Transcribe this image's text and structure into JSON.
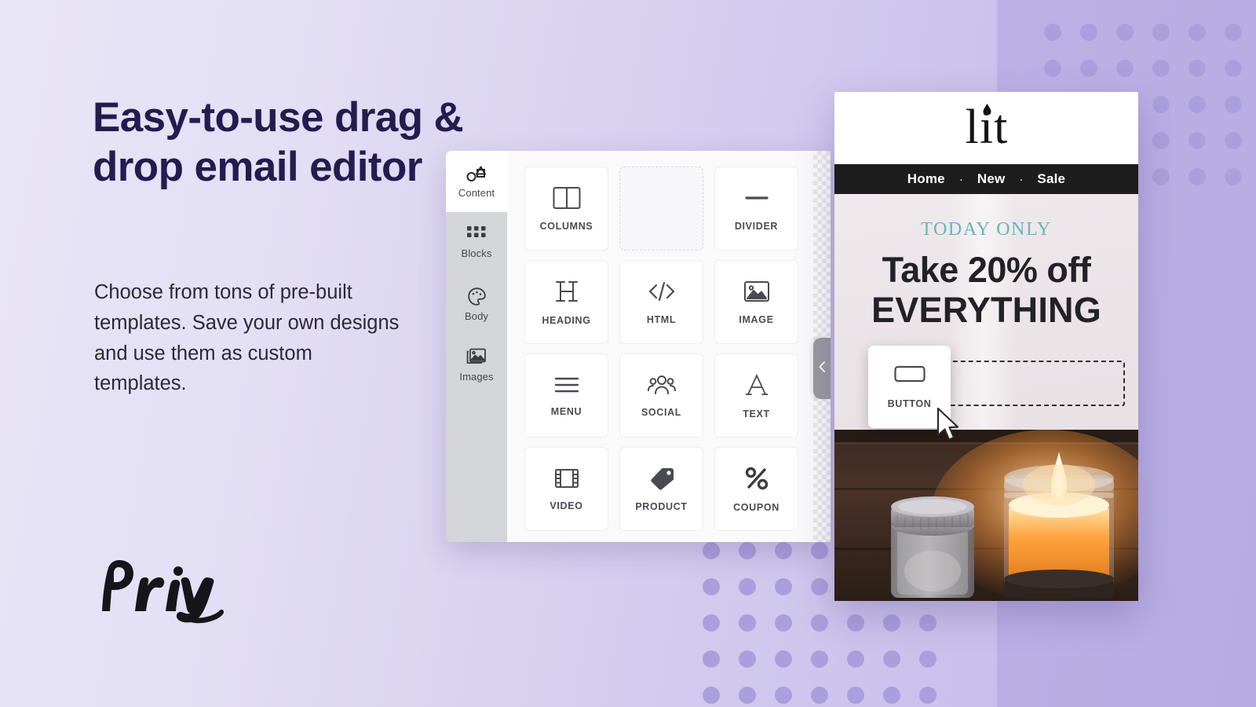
{
  "background": {
    "gradient_from": "#e9e6f7",
    "gradient_to": "#c3b9e9",
    "band_color": "#bcb1e6",
    "dot_color": "#aa9fdd"
  },
  "marketing": {
    "headline": "Easy-to-use drag & drop email editor",
    "subcopy": "Choose from tons of pre-built templates. Save your own designs and use them as custom templates.",
    "headline_color": "#241b4e",
    "brand_logo": "Privy"
  },
  "editor": {
    "sidebar": {
      "items": [
        {
          "label": "Content",
          "icon": "shapes-icon",
          "active": true
        },
        {
          "label": "Blocks",
          "icon": "grid-icon",
          "active": false
        },
        {
          "label": "Body",
          "icon": "palette-icon",
          "active": false
        },
        {
          "label": "Images",
          "icon": "images-icon",
          "active": false
        }
      ]
    },
    "blocks": [
      {
        "label": "COLUMNS",
        "icon": "columns-icon",
        "placeholder": false
      },
      {
        "label": "",
        "icon": "empty-slot-icon",
        "placeholder": true
      },
      {
        "label": "DIVIDER",
        "icon": "divider-icon",
        "placeholder": false
      },
      {
        "label": "HEADING",
        "icon": "heading-icon",
        "placeholder": false
      },
      {
        "label": "HTML",
        "icon": "code-icon",
        "placeholder": false
      },
      {
        "label": "IMAGE",
        "icon": "image-icon",
        "placeholder": false
      },
      {
        "label": "MENU",
        "icon": "menu-icon",
        "placeholder": false
      },
      {
        "label": "SOCIAL",
        "icon": "people-icon",
        "placeholder": false
      },
      {
        "label": "TEXT",
        "icon": "text-a-icon",
        "placeholder": false
      },
      {
        "label": "VIDEO",
        "icon": "film-icon",
        "placeholder": false
      },
      {
        "label": "PRODUCT",
        "icon": "tag-icon",
        "placeholder": false
      },
      {
        "label": "COUPON",
        "icon": "percent-icon",
        "placeholder": false
      }
    ],
    "collapse_handle_icon": "chevron-left-icon",
    "dragging_block": {
      "label": "BUTTON",
      "icon": "button-icon"
    },
    "cursor_icon": "mouse-pointer-icon"
  },
  "email_preview": {
    "logo_text": "lit",
    "nav": {
      "links": [
        "Home",
        "New",
        "Sale"
      ],
      "separator": "·",
      "background": "#1d1d1d"
    },
    "hero": {
      "eyebrow": "TODAY ONLY",
      "eyebrow_color": "#64b6bd",
      "line1": "Take 20% off",
      "line2": "EVERYTHING",
      "drop_zone_visible": true
    },
    "photo": {
      "alt": "two mason jar candles on dark wood, right one lit"
    }
  }
}
